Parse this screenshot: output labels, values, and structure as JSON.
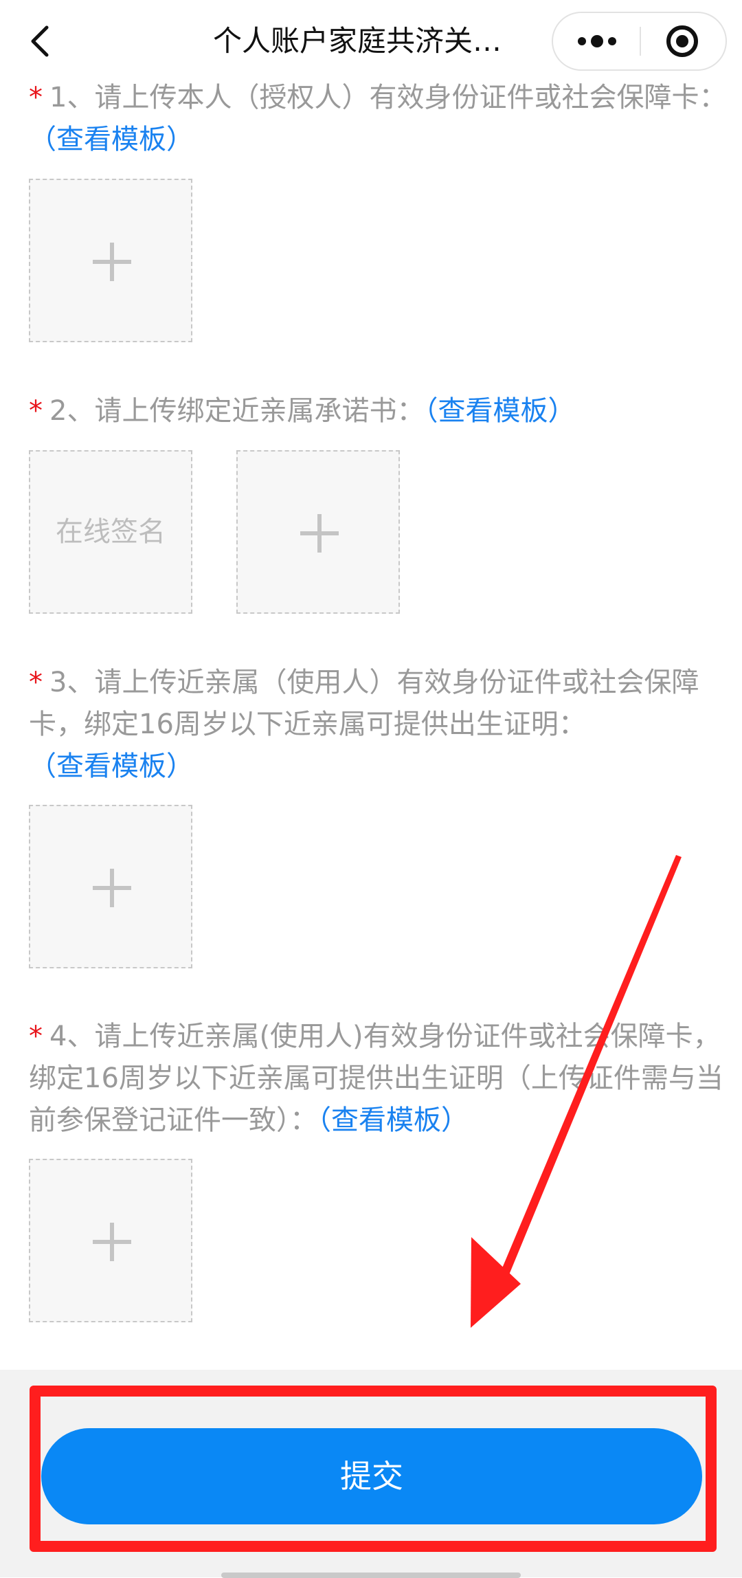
{
  "header": {
    "title": "个人账户家庭共济关…",
    "back_icon": "chevron-left-icon",
    "more_icon": "more-dots-icon",
    "close_icon": "mini-program-close-icon"
  },
  "sections": [
    {
      "required_mark": "*",
      "text": "1、请上传本人（授权人）有效身份证件或社会保障卡：",
      "link": "（查看模板）"
    },
    {
      "required_mark": "*",
      "text": "2、请上传绑定近亲属承诺书：",
      "link": "（查看模板）",
      "sign_label": "在线签名"
    },
    {
      "required_mark": "*",
      "text": "3、请上传近亲属（使用人）有效身份证件或社会保障卡，绑定16周岁以下近亲属可提供出生证明：",
      "link": "（查看模板）"
    },
    {
      "required_mark": "*",
      "text": "4、请上传近亲属(使用人)有效身份证件或社会保障卡，绑定16周岁以下近亲属可提供出生证明（上传证件需与当前参保登记证件一致）：",
      "link": "（查看模板）"
    }
  ],
  "upload_icon": "plus-icon",
  "footer": {
    "submit_label": "提交"
  },
  "colors": {
    "accent": "#0a88f5",
    "link": "#1a82f0",
    "required": "#e8141a",
    "annotation": "#ff1e1e"
  }
}
